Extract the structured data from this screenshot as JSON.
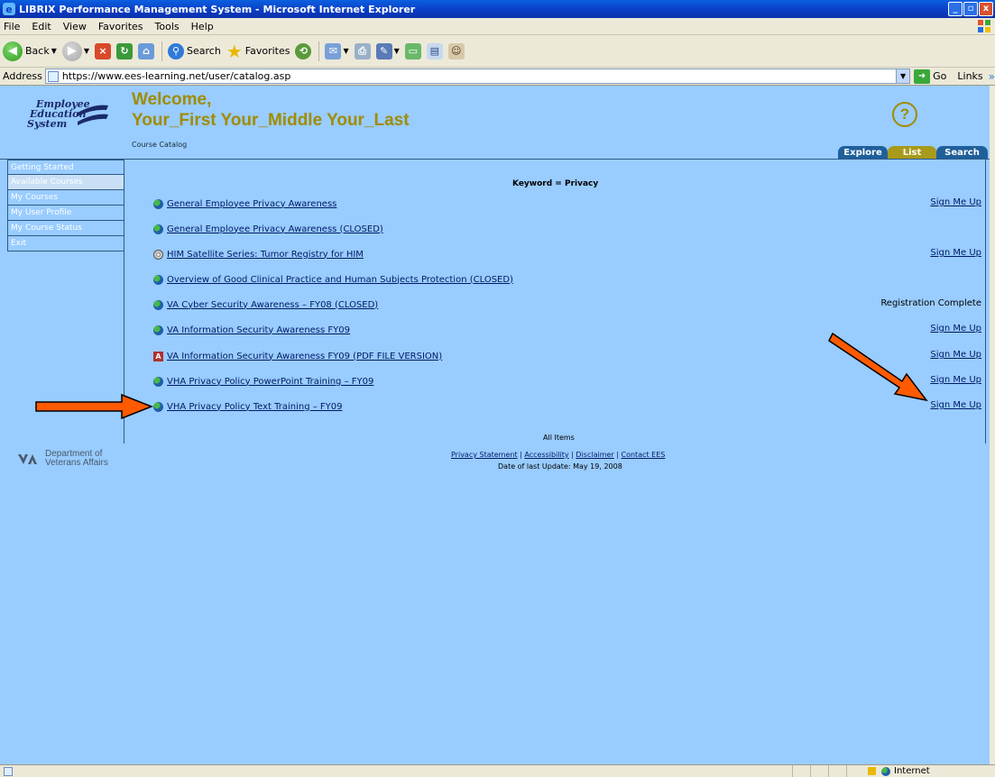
{
  "window": {
    "title": "LIBRIX Performance Management System - Microsoft Internet Explorer",
    "minimize": "_",
    "maximize": "▫",
    "close": "x"
  },
  "menu": [
    "File",
    "Edit",
    "View",
    "Favorites",
    "Tools",
    "Help"
  ],
  "toolbar": {
    "back_label": "Back",
    "search_label": "Search",
    "favorites_label": "Favorites"
  },
  "address": {
    "label": "Address",
    "url": "https://www.ees-learning.net/user/catalog.asp",
    "go_label": "Go",
    "links_label": "Links"
  },
  "header": {
    "logo_line1": "Employee",
    "logo_line2": "Education",
    "logo_line3": "System",
    "welcome": "Welcome,",
    "user_name": "Your_First Your_Middle Your_Last",
    "breadcrumb": "Course Catalog",
    "help_glyph": "?"
  },
  "tabs": [
    "Explore",
    "List",
    "Search"
  ],
  "active_tab": "List",
  "nav": [
    {
      "label": "Getting Started"
    },
    {
      "label": "Available Courses"
    },
    {
      "label": "My Courses"
    },
    {
      "label": "My User Profile"
    },
    {
      "label": "My Course Status"
    },
    {
      "label": "Exit"
    }
  ],
  "active_nav": "Available Courses",
  "keyword_heading": "Keyword = Privacy",
  "courses": [
    {
      "title": "General Employee Privacy Awareness",
      "icon": "globe-icon",
      "action": "Sign Me Up"
    },
    {
      "title": "General Employee Privacy Awareness (CLOSED)",
      "icon": "globe-icon",
      "action": ""
    },
    {
      "title": "HIM Satellite Series: Tumor Registry for HIM",
      "icon": "disc-icon",
      "action": "Sign Me Up"
    },
    {
      "title": "Overview of Good Clinical Practice and Human Subjects Protection (CLOSED)",
      "icon": "globe-icon",
      "action": ""
    },
    {
      "title": "VA Cyber Security Awareness – FY08 (CLOSED)",
      "icon": "globe-icon",
      "status": "Registration Complete"
    },
    {
      "title": "VA Information Security Awareness FY09",
      "icon": "globe-icon",
      "action": "Sign Me Up"
    },
    {
      "title": "VA Information Security Awareness FY09 (PDF FILE VERSION)",
      "icon": "pdf-icon",
      "action": "Sign Me Up"
    },
    {
      "title": "VHA Privacy Policy PowerPoint Training – FY09",
      "icon": "globe-icon",
      "action": "Sign Me Up"
    },
    {
      "title": "VHA Privacy Policy Text Training – FY09",
      "icon": "globe-icon",
      "action": "Sign Me Up"
    }
  ],
  "all_items": "All Items",
  "footer": {
    "va_line1": "Department of",
    "va_line2": "Veterans Affairs",
    "links": [
      "Privacy Statement",
      "Accessibility",
      "Disclaimer",
      "Contact EES"
    ],
    "separator": " | ",
    "last_update": "Date of last Update: May 19, 2008"
  },
  "status": {
    "zone": "Internet"
  },
  "colors": {
    "page_bg": "#99ccff",
    "accent_gold": "#a08c00",
    "tab_blue": "#1f5f9a",
    "arrow": "#ff5a00"
  }
}
